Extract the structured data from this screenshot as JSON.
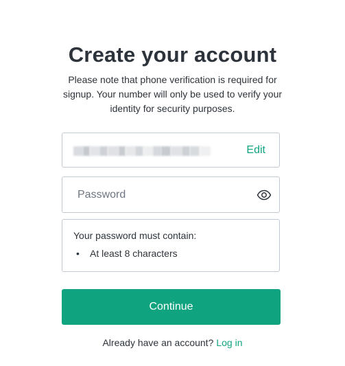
{
  "header": {
    "title": "Create your account",
    "subtitle": "Please note that phone verification is required for signup. Your number will only be used to verify your identity for security purposes."
  },
  "email": {
    "edit_label": "Edit"
  },
  "password": {
    "placeholder": "Password",
    "value": ""
  },
  "requirements": {
    "title": "Your password must contain:",
    "items": [
      {
        "bullet": "•",
        "text": "At least 8 characters"
      }
    ]
  },
  "actions": {
    "continue_label": "Continue"
  },
  "footer": {
    "prompt": "Already have an account?",
    "login_label": "Log in"
  },
  "colors": {
    "accent": "#10a37f",
    "text": "#2d333a",
    "border": "#c2c8d0"
  },
  "icons": {
    "password_toggle": "eye-icon"
  }
}
